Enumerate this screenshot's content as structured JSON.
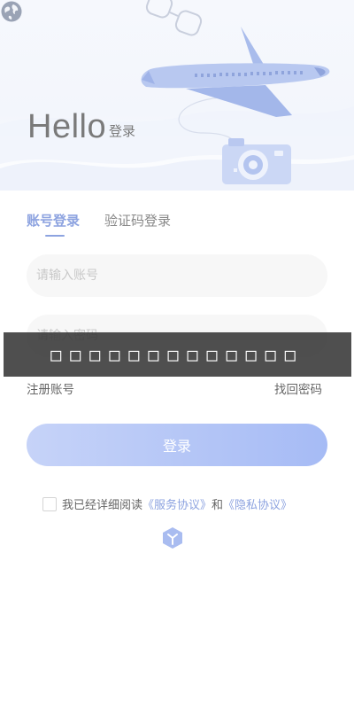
{
  "header": {
    "hello": "Hello",
    "subtitle": "登录",
    "globe_icon": "globe-icon",
    "illustration": [
      "airplane",
      "camera",
      "glasses"
    ]
  },
  "tabs": [
    {
      "label": "账号登录",
      "active": true
    },
    {
      "label": "验证码登录",
      "active": false
    }
  ],
  "form": {
    "account_placeholder": "请输入账号",
    "password_placeholder": "请输入密码"
  },
  "toast": {
    "text": "□□□□□□□□□□□□□",
    "visible": true
  },
  "links": {
    "register": "注册账号",
    "forgot": "找回密码"
  },
  "login_button": "登录",
  "agreement": {
    "prefix": "我已经详细阅读",
    "service": "《服务协议》",
    "and": "和",
    "privacy": "《隐私协议》",
    "checked": false
  },
  "footer": {
    "logo_icon": "app-logo-icon"
  },
  "colors": {
    "accent": "#8da3e0",
    "button_start": "#c6d3f8",
    "button_end": "#a6bbf5",
    "input_bg": "#f7f7f7"
  }
}
